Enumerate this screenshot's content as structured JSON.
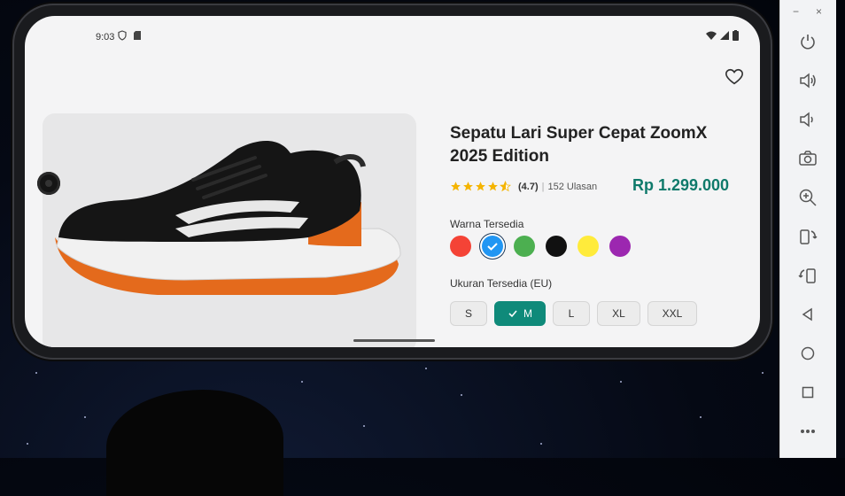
{
  "status_bar": {
    "time": "9:03"
  },
  "product": {
    "title": "Sepatu Lari Super Cepat ZoomX 2025 Edition",
    "rating_value": "(4.7)",
    "separator": "|",
    "reviews": "152 Ulasan",
    "price": "Rp 1.299.000",
    "rating": 4.7
  },
  "colors": {
    "label": "Warna Tersedia",
    "options": [
      "#f44336",
      "#2196f3",
      "#4caf50",
      "#111111",
      "#ffeb3b",
      "#9c27b0"
    ],
    "selected_index": 1
  },
  "sizes": {
    "label": "Ukuran Tersedia (EU)",
    "options": [
      "S",
      "M",
      "L",
      "XL",
      "XXL"
    ],
    "selected": "M"
  },
  "emulator_panel": {
    "minimize": "−",
    "close": "×",
    "tools": [
      "power-icon",
      "volume-up-icon",
      "volume-down-icon",
      "camera-icon",
      "zoom-icon",
      "rotate-left-icon",
      "rotate-right-icon",
      "back-icon",
      "home-icon",
      "overview-icon",
      "more-icon"
    ]
  }
}
